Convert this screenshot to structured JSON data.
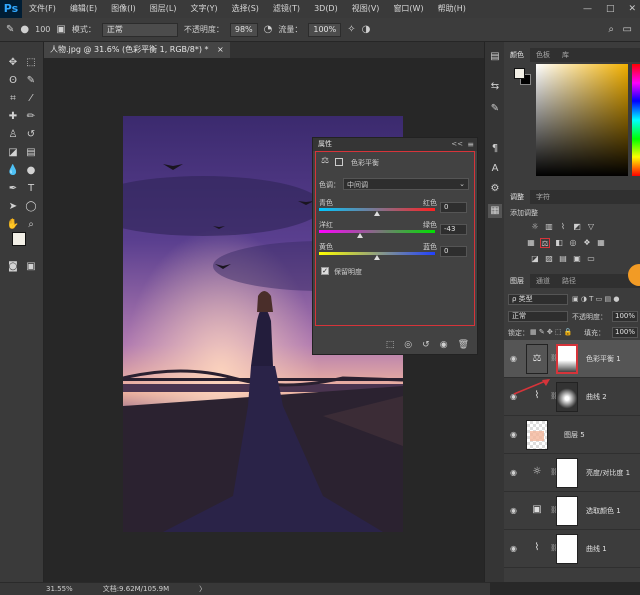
{
  "app": {
    "logo": "Ps"
  },
  "menubar": {
    "items": [
      "文件(F)",
      "编辑(E)",
      "图像(I)",
      "图层(L)",
      "文字(Y)",
      "选择(S)",
      "滤镜(T)",
      "3D(D)",
      "视图(V)",
      "窗口(W)",
      "帮助(H)"
    ],
    "window_controls": [
      "—",
      "□",
      "✕"
    ]
  },
  "options": {
    "size": "100",
    "mode_label": "模式：",
    "mode_value": "正常",
    "opacity_label": "不透明度：",
    "opacity_value": "98%",
    "flow_label": "流量：",
    "flow_value": "100%"
  },
  "document": {
    "tab_title": "人物.jpg @ 31.6% (色彩平衡 1, RGB/8*) *",
    "tab_close": "×"
  },
  "status": {
    "zoom": "31.55%",
    "doc_info": "文档:9.62M/105.9M",
    "arrow": "〉"
  },
  "properties": {
    "tab": "属性",
    "collapse": "<<",
    "menu": "≡",
    "title": "色彩平衡",
    "tone_label": "色调：",
    "tone_value": "中间调",
    "sliders": [
      {
        "left": "青色",
        "right": "红色",
        "value": "0",
        "position": 0.5
      },
      {
        "left": "洋红",
        "right": "绿色",
        "value": "-43",
        "position": 0.35
      },
      {
        "left": "黄色",
        "right": "蓝色",
        "value": "0",
        "position": 0.5
      }
    ],
    "preserve_luminosity": "保留明度",
    "preserve_checked": true
  },
  "color_panel": {
    "tabs": [
      "颜色",
      "色板",
      "库"
    ]
  },
  "adjustments_panel": {
    "tabs": [
      "调整",
      "字符"
    ],
    "add_label": "添加调整"
  },
  "layers_panel": {
    "tabs": [
      "图层",
      "通道",
      "路径"
    ],
    "filter_label": "ρ 类型",
    "blend_mode": "正常",
    "opacity_label": "不透明度：",
    "opacity_value": "100%",
    "lock_label": "锁定：",
    "fill_label": "填充：",
    "fill_value": "100%",
    "layers": [
      {
        "name": "色彩平衡 1",
        "icon": "balance-icon",
        "selected": true
      },
      {
        "name": "曲线 2",
        "icon": "curves-icon",
        "selected": false
      },
      {
        "name": "图层 5",
        "icon": "pixel-layer",
        "selected": false
      },
      {
        "name": "亮度/对比度 1",
        "icon": "brightness-icon",
        "selected": false
      },
      {
        "name": "选取颜色 1",
        "icon": "selective-color-icon",
        "selected": false
      },
      {
        "name": "曲线 1",
        "icon": "curves-icon",
        "selected": false
      }
    ]
  },
  "colors": {
    "accent_red": "#d6343a",
    "ps_blue": "#31a8ff",
    "orange_badge": "#f29b25"
  }
}
